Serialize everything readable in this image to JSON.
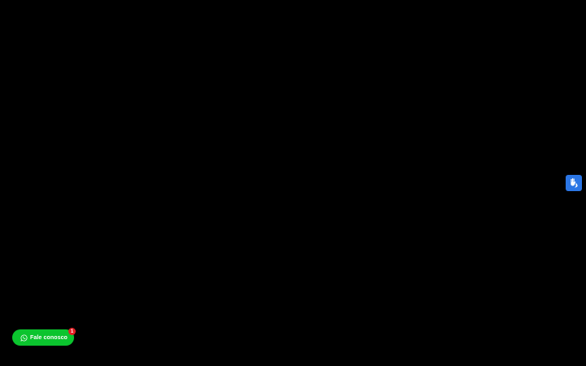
{
  "accessibility_widget": {
    "icon": "sign-language-hands-icon",
    "color": "#2b76e5"
  },
  "whatsapp_button": {
    "label": "Fale conosco",
    "icon": "whatsapp-icon",
    "color": "#0bc42e",
    "badge_count": "1",
    "badge_color": "#e61f25"
  }
}
